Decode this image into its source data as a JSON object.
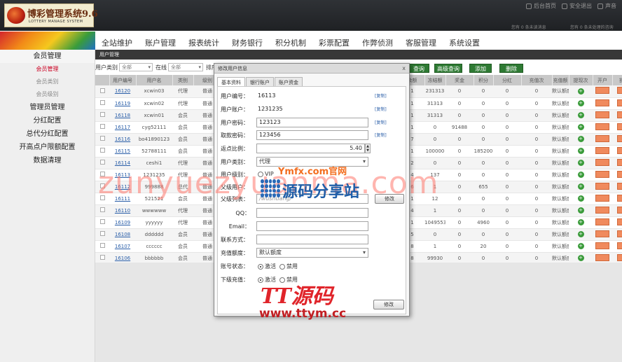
{
  "brand": {
    "title": "博彩管理系统9.6",
    "subtitle": "LOTTERY MANAGE SYSTEM"
  },
  "toplinks": {
    "home": "后台首页",
    "logout": "安全退出",
    "sound": "声音"
  },
  "topinfo": {
    "left": "您有 0 条未读消息",
    "right": "您有 0 条未处理的咨询"
  },
  "nav": [
    "全站维护",
    "账户管理",
    "报表统计",
    "财务银行",
    "积分机制",
    "彩票配置",
    "作弊侦测",
    "客服管理",
    "系统设置"
  ],
  "sidebar": {
    "member_mgmt": "会员管理",
    "sub": [
      "会员管理",
      "会员类别",
      "会员级别"
    ],
    "items": [
      "管理员管理",
      "分红配置",
      "总代分红配置",
      "开高点户限额配置",
      "数据清理"
    ]
  },
  "breadcrumb": "用户管理",
  "filter": {
    "type_label": "用户类别",
    "type_value": "全部",
    "in_label": "在线",
    "in_value": "全部",
    "sort_label": "排序",
    "search_btn": "查询",
    "adv_btn": "高级查询",
    "add_btn": "添加",
    "del_btn": "删除"
  },
  "table": {
    "headers": [
      "",
      "用户编号",
      "用户名",
      "类别",
      "级别",
      "",
      "",
      "",
      "余额",
      "冻结额",
      "奖金",
      "积分",
      "分红",
      "充值次",
      "充值额",
      "提现次",
      "开户",
      "操作"
    ],
    "rows": [
      {
        "id": "16120",
        "name": "xcwin03",
        "type": "代理",
        "level": "普通",
        "rate": "1",
        "balance": "231313",
        "frz": "0",
        "bonus": "0",
        "pts": "0",
        "div": "0",
        "tier": "默认额度"
      },
      {
        "id": "16119",
        "name": "xcwin02",
        "type": "代理",
        "level": "普通",
        "rate": "1",
        "balance": "31313",
        "frz": "0",
        "bonus": "0",
        "pts": "0",
        "div": "0",
        "tier": "默认额度"
      },
      {
        "id": "16118",
        "name": "xcwin01",
        "type": "会员",
        "level": "普通",
        "rate": "1",
        "balance": "31313",
        "frz": "0",
        "bonus": "0",
        "pts": "0",
        "div": "0",
        "tier": "默认额度"
      },
      {
        "id": "16117",
        "name": "cyg52111",
        "type": "会员",
        "level": "普通",
        "rate": "1",
        "balance": "0",
        "frz": "91488",
        "bonus": "0",
        "pts": "0",
        "div": "0",
        "tier": "默认额度"
      },
      {
        "id": "16116",
        "name": "bo41890123",
        "type": "会员",
        "level": "普通",
        "rate": "7",
        "balance": "0",
        "frz": "0",
        "bonus": "0",
        "pts": "0",
        "div": "0",
        "tier": "默认额度"
      },
      {
        "id": "16115",
        "name": "52788111",
        "type": "会员",
        "level": "普通",
        "rate": "1",
        "balance": "100000",
        "frz": "0",
        "bonus": "185200",
        "pts": "0",
        "div": "0",
        "tier": "默认额度"
      },
      {
        "id": "16114",
        "name": "ceshi1",
        "type": "代理",
        "level": "普通",
        "rate": "2",
        "balance": "0",
        "frz": "0",
        "bonus": "0",
        "pts": "0",
        "div": "0",
        "tier": "默认额度"
      },
      {
        "id": "16113",
        "name": "1231235",
        "type": "代理",
        "level": "普通",
        "rate": "4",
        "balance": "137",
        "frz": "0",
        "bonus": "0",
        "pts": "0",
        "div": "0",
        "tier": "默认额度"
      },
      {
        "id": "16112",
        "name": "999888",
        "type": "总代",
        "level": "普通",
        "rate": "6",
        "balance": "1",
        "frz": "0",
        "bonus": "655",
        "pts": "0",
        "div": "0",
        "tier": "默认额度"
      },
      {
        "id": "16111",
        "name": "521521",
        "type": "会员",
        "level": "普通",
        "rate": "1",
        "balance": "12",
        "frz": "0",
        "bonus": "0",
        "pts": "0",
        "div": "0",
        "tier": "默认额度"
      },
      {
        "id": "16110",
        "name": "wwwwww",
        "type": "代理",
        "level": "普通",
        "rate": "4",
        "balance": "1",
        "frz": "0",
        "bonus": "0",
        "pts": "0",
        "div": "0",
        "tier": "默认额度"
      },
      {
        "id": "16109",
        "name": "yyyyyy",
        "type": "代理",
        "level": "普通",
        "rate": "1",
        "balance": "1049553",
        "frz": "0",
        "bonus": "4960",
        "pts": "0",
        "div": "0",
        "tier": "默认额度"
      },
      {
        "id": "16108",
        "name": "dddddd",
        "type": "会员",
        "level": "普通",
        "rate": "5",
        "balance": "0",
        "frz": "0",
        "bonus": "0",
        "pts": "0",
        "div": "0",
        "tier": "默认额度"
      },
      {
        "id": "16107",
        "name": "cccccc",
        "type": "会员",
        "level": "普通",
        "rate": "8",
        "balance": "1",
        "frz": "0",
        "bonus": "20",
        "pts": "0",
        "div": "0",
        "tier": "默认额度"
      },
      {
        "id": "16106",
        "name": "bbbbbb",
        "type": "会员",
        "level": "普通",
        "rate": "8",
        "balance": "99930",
        "frz": "0",
        "bonus": "0",
        "pts": "0",
        "div": "0",
        "tier": "默认额度"
      }
    ]
  },
  "dialog": {
    "title": "修改用户信息",
    "close": "x",
    "tabs": [
      "基本资料",
      "银行账户",
      "账户资金"
    ],
    "fields": {
      "uid_label": "用户编号：",
      "uid": "16113",
      "uname_label": "用户账户：",
      "uname": "1231235",
      "pwd_label": "用户密码：",
      "pwd": "123123",
      "wpwd_label": "取款密码：",
      "wpwd": "123456",
      "rebate_label": "返点比例：",
      "rebate": "5.40",
      "type_label": "用户类别：",
      "type": "代理",
      "level_label": "用户级别：",
      "level_vip": "VIP",
      "parent_label": "父级用户：",
      "parents_label": "父级列表：",
      "parents_ph": "/wushuang/",
      "qq_label": "QQ：",
      "email_label": "Email：",
      "contact_label": "联系方式：",
      "limit_label": "充值额度：",
      "limit": "默认额度",
      "status_label": "账号状态：",
      "sub_label": "下级充值：",
      "enable": "激活",
      "disable": "禁用",
      "copy": "[复制]",
      "edit_btn": "修改",
      "submit_btn": "修改"
    }
  },
  "watermarks": {
    "big": "zunyuezyuanma.com",
    "ymfx": "Ymfx.com官网",
    "ymcn": "源码分享站",
    "tt": "TT源码",
    "url": "www.ttym.cc"
  }
}
